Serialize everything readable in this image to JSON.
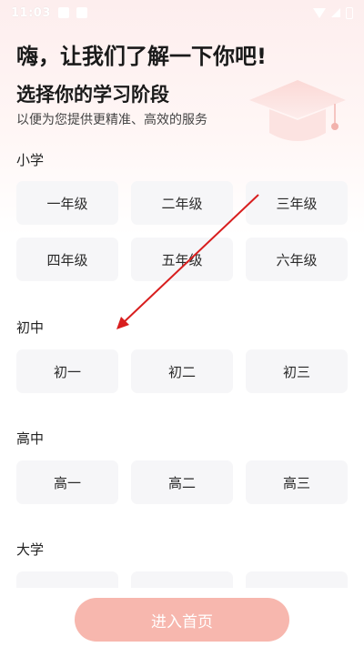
{
  "status_bar": {
    "time": "11:03"
  },
  "header": {
    "greeting": "嗨，让我们了解一下你吧!",
    "title": "选择你的学习阶段",
    "subtitle": "以便为您提供更精准、高效的服务"
  },
  "sections": [
    {
      "label": "小学",
      "grades": [
        "一年级",
        "二年级",
        "三年级",
        "四年级",
        "五年级",
        "六年级"
      ]
    },
    {
      "label": "初中",
      "grades": [
        "初一",
        "初二",
        "初三"
      ]
    },
    {
      "label": "高中",
      "grades": [
        "高一",
        "高二",
        "高三"
      ]
    },
    {
      "label": "大学",
      "grades": [
        "",
        "",
        ""
      ]
    }
  ],
  "enter_button": {
    "label": "进入首页"
  },
  "colors": {
    "accent": "#f7b7ae",
    "annotation_arrow": "#d81e1e",
    "button_bg": "#f6f6f8"
  },
  "icons": [
    "wifi-icon",
    "signal-icon",
    "battery-icon",
    "graduation-cap-icon"
  ]
}
